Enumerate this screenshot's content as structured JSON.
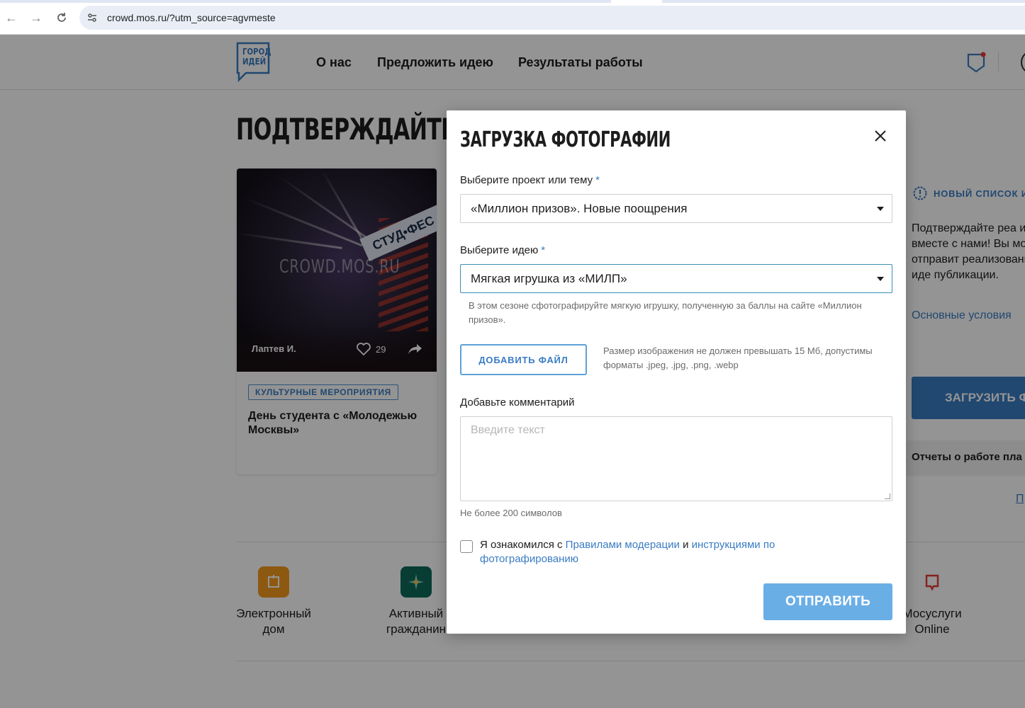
{
  "browser": {
    "url": "crowd.mos.ru/?utm_source=agvmeste"
  },
  "header": {
    "logo_line1": "ГОРОД",
    "logo_line2": "ИДЕЙ",
    "nav": [
      "О нас",
      "Предложить идею",
      "Результаты работы"
    ]
  },
  "page": {
    "title": "ПОДТВЕРЖДАЙТЕ РЕА",
    "card": {
      "watermark": "CROWD.MOS.RU",
      "banner_text": "СТУД•ФЕС",
      "author": "Лаптев И.",
      "likes": "29",
      "tag": "КУЛЬТУРНЫЕ МЕРОПРИЯТИЯ",
      "title": "День студента с «Молодежью Москвы»"
    },
    "right_panel": {
      "new_list": "НОВЫЙ СПИСОК И",
      "text": "Подтверждайте реа идей вместе с нами! Вы можете отправит реализованных иде публикации.",
      "link": "Основные условия",
      "upload_button": "ЗАГРУЗИТЬ Ф",
      "reports": "Отчеты о работе пла",
      "more_link": "П"
    },
    "services": [
      {
        "name": "Электронный дом",
        "color": "#f39a1e"
      },
      {
        "name": "Активный гражданин",
        "color": "#0f6a5a"
      },
      {
        "name": "Мосуслуги Online",
        "color": "#ffffff"
      }
    ]
  },
  "modal": {
    "title": "ЗАГРУЗКА ФОТОГРАФИИ",
    "project_label": "Выберите проект или тему",
    "project_value": "«Миллион призов». Новые поощрения",
    "idea_label": "Выберите идею",
    "idea_value": "Мягкая игрушка из «МИЛП»",
    "required_mark": "*",
    "hint": "В этом сезоне сфотографируйте мягкую игрушку, полученную за баллы на сайте «Миллион призов».",
    "add_file": "ДОБАВИТЬ ФАЙЛ",
    "file_note": "Размер изображения не должен превышать 15 Мб, допустимы форматы .jpeg, .jpg, .png, .webp",
    "comment_label": "Добавьте комментарий",
    "comment_placeholder": "Введите текст",
    "char_limit": "Не более 200 символов",
    "agree_prefix": "Я ознакомился с",
    "agree_link1": "Правилами модерации",
    "agree_and": "и",
    "agree_link2": "инструкциями по фотографированию",
    "submit": "ОТПРАВИТЬ"
  },
  "colors": {
    "accent": "#3a7cc2",
    "submit": "#6aaee6"
  }
}
